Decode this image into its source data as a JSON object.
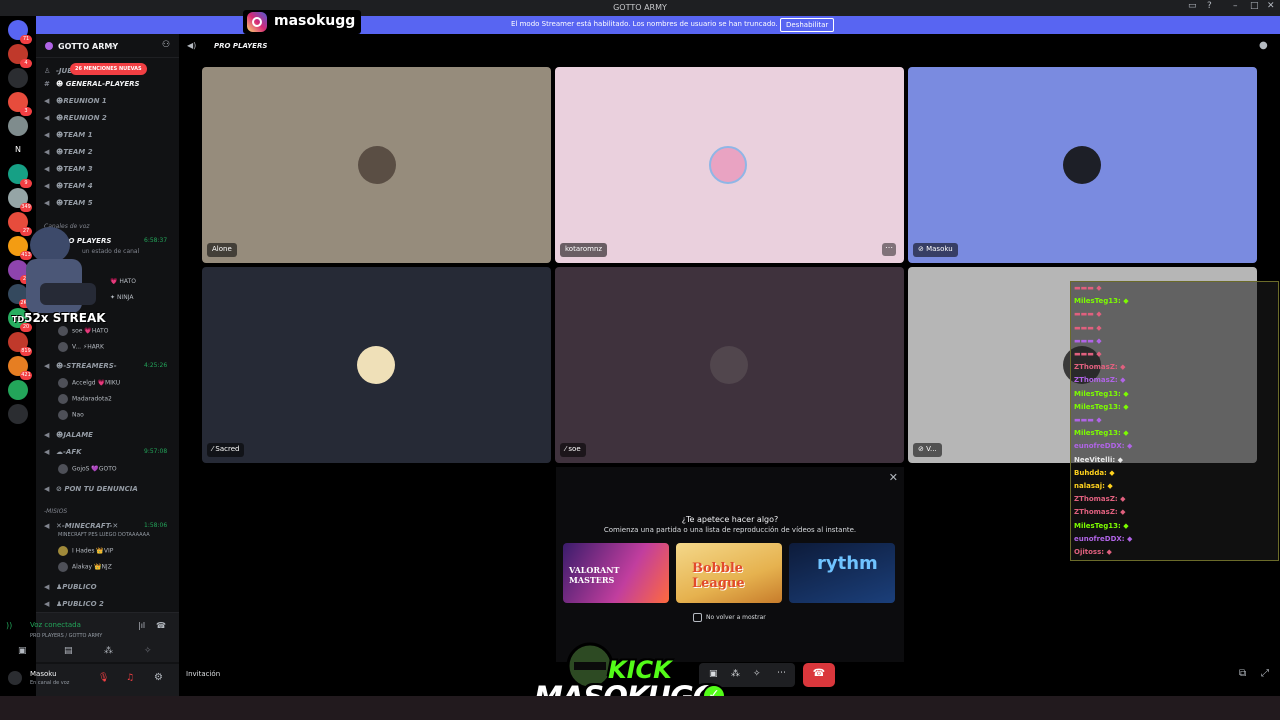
{
  "window": {
    "title": "GOTTO ARMY"
  },
  "banner": {
    "message": "El modo Streamer está habilitado. Los nombres de usuario se han truncado.",
    "disable_label": "Deshabilitar"
  },
  "server_badges": [
    "71",
    "4",
    "",
    "3",
    "",
    "N",
    "9",
    "349",
    "27",
    "413",
    "29",
    "2K+",
    "20",
    "819",
    "421",
    "",
    ""
  ],
  "guild": {
    "name": "GOTTO ARMY"
  },
  "mentions_label": "26 MENCIONES NUEVAS",
  "channels": [
    {
      "name": "JUE",
      "type": "cat"
    },
    {
      "name": "GENERAL-PLAYERS",
      "type": "text"
    },
    {
      "name": "REUNION 1",
      "type": "voice"
    },
    {
      "name": "REUNION 2",
      "type": "voice"
    },
    {
      "name": "TEAM 1",
      "type": "voice"
    },
    {
      "name": "TEAM 2",
      "type": "voice"
    },
    {
      "name": "TEAM 3",
      "type": "voice"
    },
    {
      "name": "TEAM 4",
      "type": "voice"
    },
    {
      "name": "TEAM 5",
      "type": "voice"
    }
  ],
  "voice_category": "Canales de voz",
  "pro_players": {
    "name": "PRO PLAYERS",
    "time": "6:58:37",
    "status": "un estado de canal"
  },
  "pro_members": [
    {
      "name": "",
      "tag": "HATO"
    },
    {
      "name": "",
      "tag": "NINJA"
    },
    {
      "name": "soe",
      "tag": "HATO"
    },
    {
      "name": "V...",
      "tag": "HARK"
    }
  ],
  "streamers": {
    "name": "-STREAMERS-",
    "time": "4:25:26"
  },
  "streamer_members": [
    {
      "name": "Accelgd",
      "tag": "MIKU"
    },
    {
      "name": "Madaradota2",
      "tag": ""
    },
    {
      "name": "Nao",
      "tag": ""
    }
  ],
  "jalame": "JALAME",
  "afk": {
    "name": "-AFK",
    "time": "9:57:08"
  },
  "afk_members": [
    {
      "name": "GojoS",
      "tag": "GOTO"
    }
  ],
  "denuncia": "PON TU DENUNCIA",
  "misios": "-MISIOS",
  "minecraft": {
    "name": "-MINECRAFT-",
    "time": "1:58:06",
    "status": "MINECRAFT PES LUEGO DOTAAAAAA"
  },
  "minecraft_members": [
    {
      "name": "I Hades",
      "tag": "VIP"
    },
    {
      "name": "Alakay",
      "tag": "NJZ"
    }
  ],
  "publico": [
    "PUBLICO",
    "PUBLICO 2"
  ],
  "voice_panel": {
    "status": "Voz conectada",
    "location": "PRO PLAYERS / GOTTO ARMY"
  },
  "user": {
    "name": "Masoku",
    "status": "En canal de voz"
  },
  "main": {
    "channel": "PRO PLAYERS",
    "tiles": [
      {
        "name": "Alone",
        "bg": "#968c7c"
      },
      {
        "name": "kotaromnz",
        "bg": "#ead0dd"
      },
      {
        "name": "Masoku",
        "bg": "#7a8be0"
      },
      {
        "name": "Sacred",
        "bg": "#262a36"
      },
      {
        "name": "soe",
        "bg": "#3f323d"
      },
      {
        "name": "V...",
        "bg": "#b6b6b6"
      }
    ],
    "activity": {
      "question": "¿Te apetece hacer algo?",
      "subtitle": "Comienza una partida o una lista de reproducción de vídeos al instante.",
      "cards": [
        "VALORANT MASTERS",
        "Bobble League",
        "rythm"
      ],
      "dont_show": "No volver a mostrar"
    },
    "invite": "Invitación"
  },
  "overlay": {
    "instagram": "masokugg",
    "streak": "52x STREAK",
    "streak_prefix": "TD",
    "kick_top": "KICK",
    "kick_bottom": "MASOKUGG",
    "chat": [
      {
        "user": "",
        "color": "#e0607e"
      },
      {
        "user": "MilesTeg13:",
        "color": "#7cfc00"
      },
      {
        "user": "",
        "color": "#e0607e"
      },
      {
        "user": "",
        "color": "#e0607e"
      },
      {
        "user": "",
        "color": "#b064e6"
      },
      {
        "user": "",
        "color": "#e0607e"
      },
      {
        "user": "ZThomasZ:",
        "color": "#e0607e"
      },
      {
        "user": "ZThomasZ:",
        "color": "#b064e6"
      },
      {
        "user": "MilesTeg13:",
        "color": "#7cfc00"
      },
      {
        "user": "MilesTeg13:",
        "color": "#7cfc00"
      },
      {
        "user": "",
        "color": "#b064e6"
      },
      {
        "user": "MilesTeg13:",
        "color": "#7cfc00"
      },
      {
        "user": "eunofreDDX:",
        "color": "#b064e6"
      },
      {
        "user": "NeeVitelli:",
        "color": "#e9e9e9"
      },
      {
        "user": "Buhdda:",
        "color": "#ffd21e"
      },
      {
        "user": "nalasaj:",
        "color": "#ffd21e"
      },
      {
        "user": "ZThomasZ:",
        "color": "#e0607e"
      },
      {
        "user": "ZThomasZ:",
        "color": "#e0607e"
      },
      {
        "user": "MilesTeg13:",
        "color": "#7cfc00"
      },
      {
        "user": "eunofreDDX:",
        "color": "#b064e6"
      },
      {
        "user": "Ojitoss:",
        "color": "#e0607e"
      }
    ]
  },
  "colors": {
    "blurple": "#5865f2",
    "green": "#23a55a",
    "red": "#da373c",
    "kick": "#53fc18"
  }
}
